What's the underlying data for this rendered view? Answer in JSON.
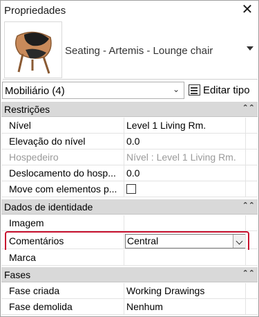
{
  "panel": {
    "title": "Propriedades",
    "close_label": "✕"
  },
  "type_selector": {
    "type_name": "Seating - Artemis - Lounge chair"
  },
  "filter": {
    "selected": "Mobiliário (4)",
    "edit_type_label": "Editar tipo"
  },
  "groups": {
    "restricoes": {
      "label": "Restrições",
      "rows": [
        {
          "name": "Nível",
          "value": "Level 1 Living Rm."
        },
        {
          "name": "Elevação do nível",
          "value": "0.0"
        },
        {
          "name": "Hospedeiro",
          "value": "Nível : Level 1 Living Rm."
        },
        {
          "name": "Deslocamento do hosp...",
          "value": "0.0"
        },
        {
          "name": "Move com elementos p...",
          "value": ""
        }
      ]
    },
    "dados": {
      "label": "Dados de identidade",
      "rows": [
        {
          "name": "Imagem",
          "value": ""
        },
        {
          "name": "Comentários",
          "value": "Central"
        },
        {
          "name": "Marca",
          "value": ""
        }
      ]
    },
    "fases": {
      "label": "Fases",
      "rows": [
        {
          "name": "Fase criada",
          "value": "Working Drawings"
        },
        {
          "name": "Fase demolida",
          "value": "Nenhum"
        }
      ]
    }
  },
  "colors": {
    "highlight": "#c8102e",
    "group_header": "#d9d9d9"
  }
}
